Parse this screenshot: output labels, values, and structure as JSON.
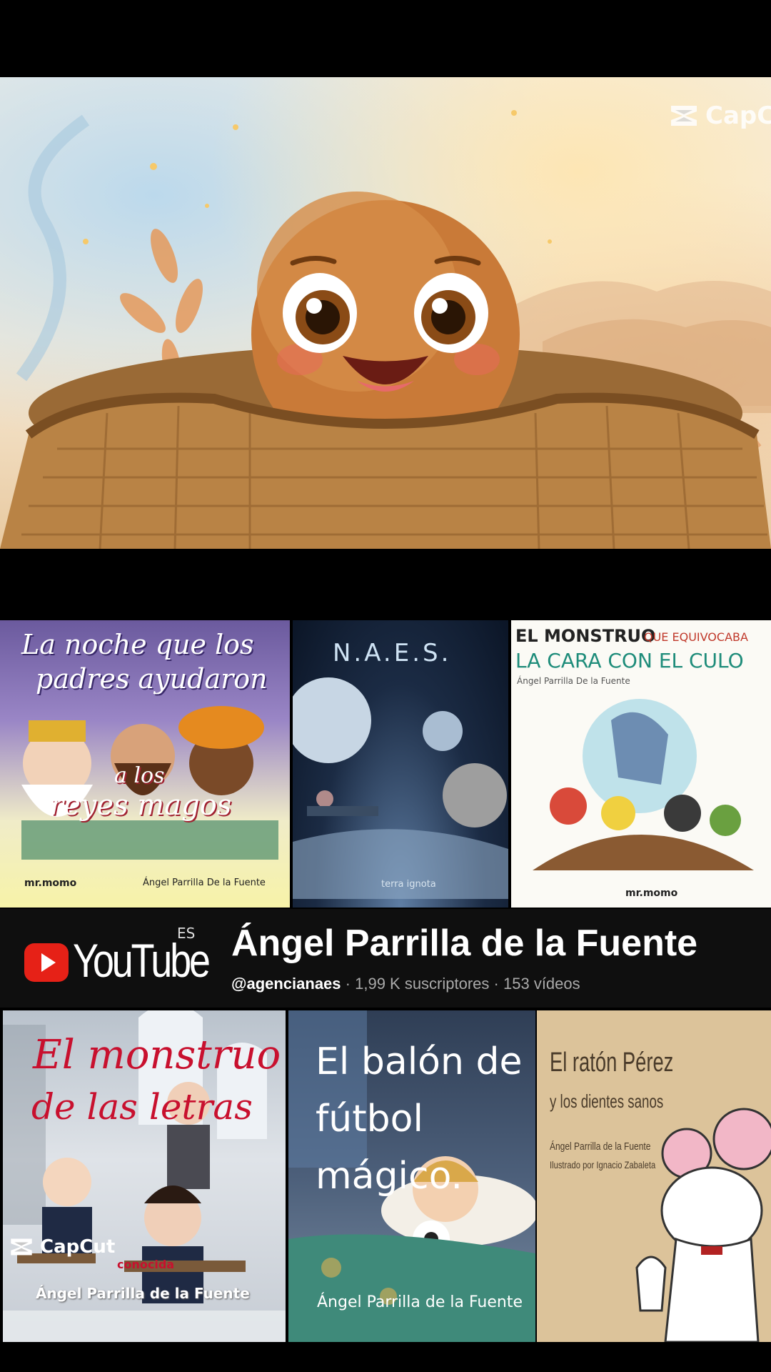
{
  "watermark": {
    "capcut_top": "CapC",
    "capcut_bottom": "CapCut"
  },
  "row1": {
    "book1": {
      "title_line1": "La noche que los",
      "title_line2": "padres ayudaron",
      "title_line3": "a los",
      "title_line4": "reyes magos",
      "publisher": "mr.momo",
      "author": "Ángel Parrilla De la Fuente"
    },
    "book2": {
      "title": "N.A.E.S.",
      "publisher": "terra ignota"
    },
    "book3": {
      "title_line1_a": "EL MONSTRUO",
      "title_line1_b": "QUE EQUIVOCABA",
      "title_line2": "LA CARA CON EL CULO",
      "author": "Ángel Parrilla De la Fuente",
      "publisher": "mr.momo"
    }
  },
  "channel": {
    "platform": "YouTube",
    "region": "ES",
    "name": "Ángel Parrilla de la Fuente",
    "handle": "@agencianaes",
    "subscribers": "1,99 K suscriptores",
    "videos": "153 vídeos",
    "separator": "·"
  },
  "row2": {
    "book4": {
      "title_line1": "El monstruo",
      "title_line2": "de las letras",
      "subtitle": "conocida",
      "author": "Ángel Parrilla de la Fuente"
    },
    "book5": {
      "title_line1": "El balón de",
      "title_line2": "fútbol",
      "title_line3": "mágico.",
      "author": "Ángel Parrilla de la Fuente"
    },
    "book6": {
      "title_line1": "El ratón Pérez",
      "title_line2": "y los dientes sanos",
      "author": "Ángel Parrilla de la Fuente",
      "illustrator": "Ilustrado por Ignacio Zabaleta"
    }
  },
  "icons": {
    "capcut": "capcut-logo-icon",
    "youtube": "youtube-play-icon"
  },
  "colors": {
    "youtube_red": "#e62117",
    "band_bg": "#0f0f0f",
    "naes_bg": "#1b2b44",
    "book3_red": "#c0392b",
    "book3_green": "#1e8c7a"
  }
}
